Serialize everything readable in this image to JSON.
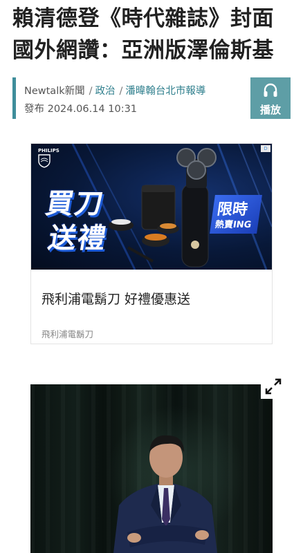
{
  "article": {
    "headline_line1": "賴清德登《時代雜誌》封面",
    "headline_line2": "國外網讚：亞洲版澤倫斯基",
    "source": "Newtalk新聞",
    "category": "政治",
    "reporter": "潘暐翰台北市報導",
    "published": "發布 2024.06.14 10:31"
  },
  "play_button": {
    "label": "播放",
    "icon": "headphones-icon"
  },
  "ad": {
    "logo_text": "PHILIPS",
    "banner_line1": "買刀",
    "banner_line2": "送禮",
    "tag_line1": "限時",
    "tag_line2": "熱賣ING",
    "title": "飛利浦電鬍刀 好禮優惠送",
    "sponsor": "飛利浦電鬍刀",
    "corner_badge": "D"
  },
  "media": {
    "expand_icon": "expand-arrows-icon"
  },
  "colors": {
    "accent": "#3f8e9b",
    "play_bg": "#5e9ea6",
    "link": "#2f7f8d"
  }
}
